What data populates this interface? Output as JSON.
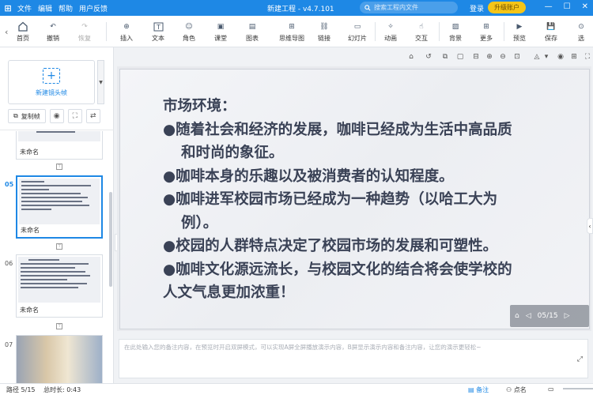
{
  "titlebar": {
    "menu": [
      "文件",
      "编辑",
      "帮助",
      "用户反馈"
    ],
    "doc_title": "新建工程 - v4.7.101",
    "search_placeholder": "搜索工程内文件",
    "login": "登录",
    "upgrade": "升级账户",
    "accent": "#1e88e5"
  },
  "toolbar": {
    "home": "首页",
    "undo": "撤销",
    "redo": "恢复",
    "insert": "插入",
    "text": "文本",
    "shape": "角色",
    "classroom": "课堂",
    "chart": "图表",
    "mindmap": "思维导图",
    "link": "链接",
    "slideshow": "幻灯片",
    "animation": "动画",
    "interact": "交互",
    "background": "背景",
    "more": "更多",
    "preview": "预览",
    "save": "保存",
    "select": "选"
  },
  "leftpanel": {
    "new_frame": "新建镜头帧",
    "copy_frame": "复制帧",
    "slides": [
      {
        "num": "",
        "name": "未命名"
      },
      {
        "num": "05",
        "name": "未命名"
      },
      {
        "num": "06",
        "name": "未命名"
      },
      {
        "num": "07",
        "name": ""
      }
    ]
  },
  "slide": {
    "lines": [
      "市场环境：",
      "●随着社会和经济的发展，咖啡已经成为生活中高品质",
      "和时尚的象征。",
      "●咖啡本身的乐趣以及被消费者的认知程度。",
      "●咖啡进军校园市场已经成为一种趋势（以哈工大为",
      "例）。",
      "●校园的人群特点决定了校园市场的发展和可塑性。",
      "●咖啡文化源远流长，与校园文化的结合将会使学校的",
      "人文气息更加浓重！"
    ],
    "pager": "05/15"
  },
  "notes": {
    "placeholder": "在此处输入您的备注内容，在预览时开启双屏模式，可以实现A屏全屏播放演示内容，B屏显示演示内容和备注内容，让您的演示更轻松~"
  },
  "status": {
    "path": "路径 5/15",
    "total_time": "总时长: 0:43",
    "notes": "备注",
    "dots": "点名"
  }
}
